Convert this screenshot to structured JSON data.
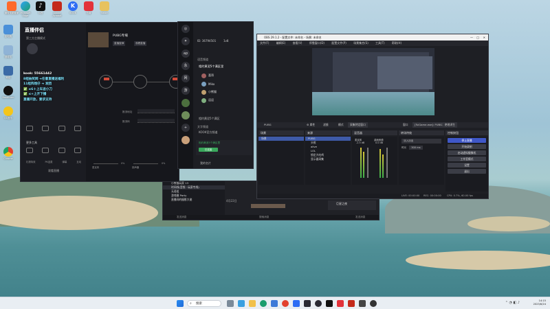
{
  "desktop_icons": [
    {
      "label": "微软电脑管家",
      "color": "#ff6a2a"
    },
    {
      "label": "Microsoft Edge",
      "color": "#1c9e6e"
    },
    {
      "label": "抖音",
      "color": "#111111"
    },
    {
      "label": "Adobe Acrobat",
      "color": "#c42a1a"
    },
    {
      "label": "KOOK",
      "color": "#2d6df4"
    },
    {
      "label": "迅雷",
      "color": "#e2323a"
    },
    {
      "label": "Steam",
      "color": "#e7c25e"
    }
  ],
  "left_icons": [
    {
      "label": "此电脑",
      "color": "#4a90d9"
    },
    {
      "label": "回收站",
      "color": "#8fb3d6"
    },
    {
      "label": "网络",
      "color": "#3a6aa6"
    },
    {
      "label": "Bandicam",
      "color": "#111111"
    },
    {
      "label": "QQ音乐",
      "color": "#f4c51a"
    },
    {
      "label": "Chrome",
      "color": "#e2412f"
    }
  ],
  "assistant": {
    "logo": "直播伴侣",
    "subtitle": "第三方主播模式",
    "game_title": "PUBG专場",
    "tags": [
      "直播旋律",
      "观看直播"
    ],
    "stats_labels": [
      "直播设置",
      "更多工具"
    ],
    "bottom_items": [
      "礼物特效",
      "PK连麦",
      "弹幕",
      "互动"
    ],
    "field1": "推流地址",
    "field2": "推流码",
    "volume_labels": [
      "麦克风",
      "扬声器"
    ],
    "volume_values": [
      "0%",
      "0%"
    ],
    "footer": "观看直播"
  },
  "kook_note": [
    "kook: 55661442",
    "8组抽奖网 ➜任意直播送福利",
    "11组阵炮仔 ➜ 发团",
    "✅ ≤6＋上车送小刀",
    "✅ ≤+上开下播",
    "直播开放，要求支持"
  ],
  "kook": {
    "server_id": "ID: 36794501",
    "level": "1v8",
    "sections": [
      "语音频道",
      "文字频道"
    ],
    "channel": "相约黄泥5个满区里",
    "users": [
      "喜哥",
      "Miko",
      "小熊猫",
      "逗逗",
      "小晴天"
    ],
    "other_channels": [
      "相约黄泥5个满区",
      "KOOK官方频道"
    ],
    "voice_status": "相约黄泥5个满区里",
    "join_btn": "已连接",
    "bottom_user": "我的名片"
  },
  "obs": {
    "title": "OBS 29.1.2 - 配置文件: 未命名 - 场景: 未命名",
    "menu": [
      "文件(F)",
      "编辑(E)",
      "查看(V)",
      "停靠窗口(D)",
      "配置文件(P)",
      "场景集合(S)",
      "工具(T)",
      "帮助(H)"
    ],
    "source_bar": [
      "PUBG",
      "⚙ 属性",
      "滤镜",
      "模式",
      "采集特定窗口",
      "窗口",
      "[TslGame.exe]: PUBG：绝地求生"
    ],
    "docks": [
      "场景",
      "来源",
      "混音器",
      "转场特效",
      "控制按钮"
    ],
    "scenes": [
      "场景"
    ],
    "sources": [
      "PUBG",
      "头框",
      "alive",
      "LOL",
      "锁定大吃鸡",
      "显示器采集"
    ],
    "mixer": [
      {
        "label": "麦克风",
        "value": "-2.5 dB"
      },
      {
        "label": "桌面音频",
        "value": "0.0 dB"
      }
    ],
    "transition": {
      "type": "淡入淡出",
      "duration_label": "时长",
      "duration": "300 ms"
    },
    "controls": [
      "停止直播",
      "开始录制",
      "启动虚拟摄像机",
      "工作室模式",
      "设置",
      "退出"
    ],
    "status": {
      "live": "LIVE: 00:00:00",
      "rec": "REC: 00:00:00",
      "cpu": "CPU: 0.7%, 60.00 fps"
    }
  },
  "chat": {
    "items": [
      "小熊猫玩家 13",
      "时间线(音频 · 玩家专线)",
      "无语组",
      "游戏圈 Party",
      "直播间的摄影大佬"
    ],
    "date": "4月22日",
    "right_title": "巨星之夜",
    "bottom": [
      "发送消息",
      "搜索消息",
      "发送消息"
    ]
  },
  "taskbar": {
    "search": "搜索",
    "time": "14:15",
    "date": "2023/6/24"
  }
}
